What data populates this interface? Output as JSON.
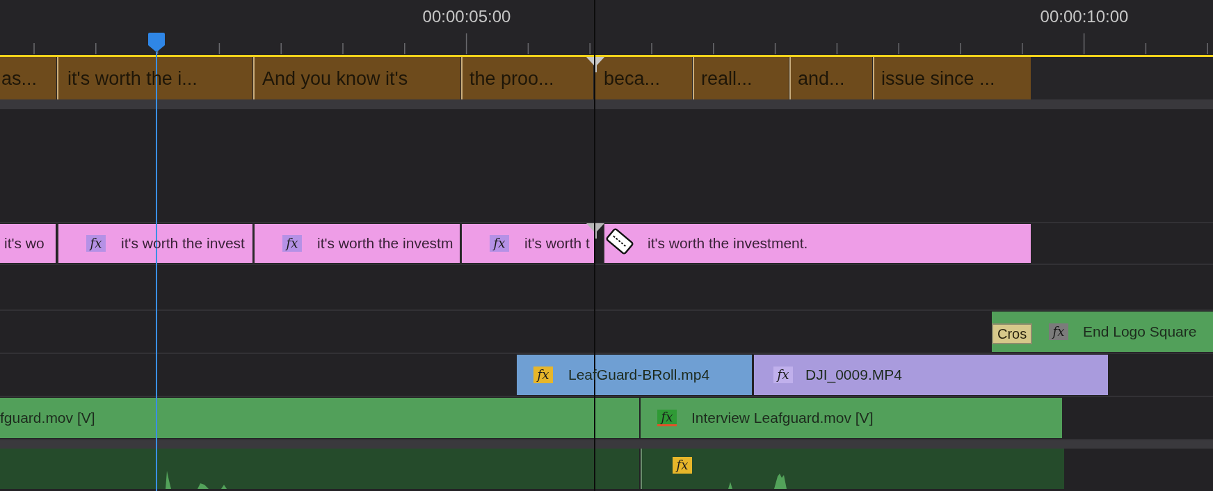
{
  "ruler": {
    "timecodes": [
      "00:00:05:00",
      "00:00:10:00"
    ]
  },
  "tracks": [
    {
      "kind": "caption",
      "clips": [
        {
          "label": "as...",
          "color": "#6e4b1c"
        },
        {
          "label": "it's worth the i...",
          "color": "#6e4b1c"
        },
        {
          "label": "And you know it's",
          "color": "#6e4b1c"
        },
        {
          "label": "the proo...",
          "color": "#6e4b1c"
        },
        {
          "label": "beca...",
          "color": "#6e4b1c"
        },
        {
          "label": "reall...",
          "color": "#6e4b1c"
        },
        {
          "label": "and...",
          "color": "#6e4b1c"
        },
        {
          "label": "issue since ...",
          "color": "#6e4b1c"
        }
      ]
    },
    {
      "kind": "empty"
    },
    {
      "kind": "graphic",
      "clips": [
        {
          "label": "it's wo",
          "color": "#ee9de7"
        },
        {
          "label": "it's worth the invest",
          "badge": {
            "text": "fx",
            "color": "#b591e6",
            "underlined": false
          },
          "color": "#ee9de7"
        },
        {
          "label": "it's worth the investm",
          "badge": {
            "text": "fx",
            "color": "#b591e6",
            "underlined": false
          },
          "color": "#ee9de7"
        },
        {
          "label": "it's worth t",
          "badge": {
            "text": "fx",
            "color": "#b591e6",
            "underlined": false
          },
          "color": "#ee9de7"
        },
        {
          "label": "it's worth the investment.",
          "color": "#ee9de7"
        }
      ]
    },
    {
      "kind": "empty"
    },
    {
      "kind": "video",
      "clips": [
        {
          "label": "End Logo Square",
          "badge": {
            "text": "fx",
            "color": "#7b7b7b",
            "underlined": false
          },
          "transition": "Cros",
          "color": "#52a05a"
        }
      ]
    },
    {
      "kind": "video",
      "clips": [
        {
          "label": "LeafGuard-BRoll.mp4",
          "badge": {
            "text": "fx",
            "color": "#e7b62a",
            "underlined": false
          },
          "color": "#6f9fd3"
        },
        {
          "label": "DJI_0009.MP4",
          "badge": {
            "text": "fx",
            "color": "#c0b0ec",
            "underlined": false
          },
          "color": "#a99bdd"
        }
      ]
    },
    {
      "kind": "video",
      "clips": [
        {
          "label": "fguard.mov [V]",
          "color": "#52a05a"
        },
        {
          "label": "Interview Leafguard.mov [V]",
          "badge": {
            "text": "fx",
            "color": "#2f9a35",
            "underlined": true
          },
          "color": "#52a05a"
        }
      ]
    },
    {
      "kind": "audio",
      "clips": [
        {
          "color": "#254b2b"
        },
        {
          "badge": {
            "text": "fx",
            "color": "#e7b62a",
            "underlined": false
          },
          "color": "#254b2b"
        }
      ]
    }
  ]
}
